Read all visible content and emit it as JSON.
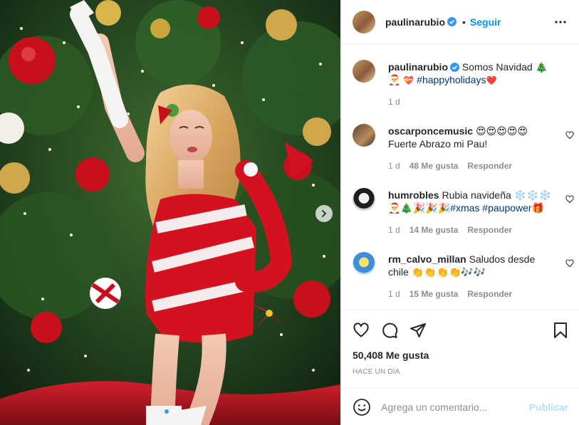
{
  "header": {
    "username": "paulinarubio",
    "separator": "•",
    "follow_label": "Seguir"
  },
  "caption": {
    "username": "paulinarubio",
    "text": "Somos Navidad 🎄🎅",
    "emoji": "💝",
    "hashtag": "#happyholidays",
    "trail": "❤️",
    "time": "1 d"
  },
  "comments": [
    {
      "username": "oscarponcemusic",
      "text": "😍😍😍😍😍Fuerte Abrazo mi Pau!",
      "time": "1 d",
      "likes": "48 Me gusta",
      "reply": "Responder"
    },
    {
      "username": "humrobles",
      "text_a": "Rubia navideña ❄️❄️❄️",
      "text_b": "🎅🎄🎉🎉🎉",
      "tag_a": "#xmas",
      "tag_b": "#paupower",
      "trail": "🎁",
      "time": "1 d",
      "likes": "14 Me gusta",
      "reply": "Responder"
    },
    {
      "username": "rm_calvo_millan",
      "text": "Saludos desde chile 👏👏👏👏🎶🎶",
      "time": "1 d",
      "likes": "15 Me gusta",
      "reply": "Responder"
    }
  ],
  "engagement": {
    "likes": "50,408 Me gusta",
    "date": "HACE UN DÍA"
  },
  "composer": {
    "placeholder": "Agrega un comentario...",
    "publish_label": "Publicar"
  },
  "carousel": {
    "slides": 2,
    "active": 1
  },
  "colors": {
    "accent": "#0095f6",
    "verified": "#3897f0",
    "publish_disabled": "#b2dffc",
    "muted": "#8e8e8e"
  },
  "icons": [
    "more-options-icon",
    "heart-icon",
    "comment-icon",
    "share-icon",
    "save-icon",
    "emoji-icon",
    "chevron-right-icon",
    "verified-badge-icon"
  ]
}
